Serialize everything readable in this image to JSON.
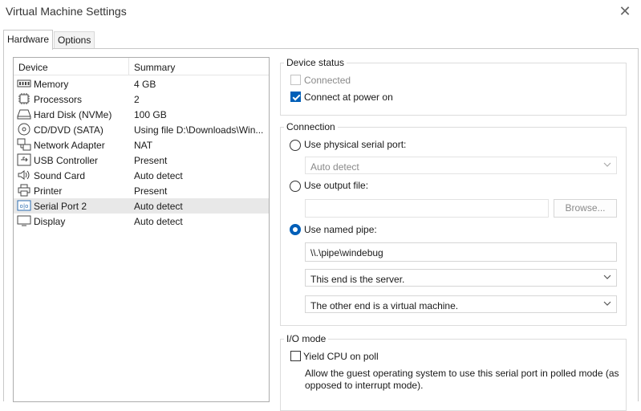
{
  "window": {
    "title": "Virtual Machine Settings",
    "close_glyph": "✕"
  },
  "tabs": [
    {
      "label": "Hardware",
      "active": true
    },
    {
      "label": "Options",
      "active": false
    }
  ],
  "device_list": {
    "headers": {
      "device": "Device",
      "summary": "Summary"
    },
    "rows": [
      {
        "icon": "memory-icon",
        "name": "Memory",
        "summary": "4 GB"
      },
      {
        "icon": "processor-icon",
        "name": "Processors",
        "summary": "2"
      },
      {
        "icon": "hard-disk-icon",
        "name": "Hard Disk (NVMe)",
        "summary": "100 GB"
      },
      {
        "icon": "cd-dvd-icon",
        "name": "CD/DVD (SATA)",
        "summary": "Using file D:\\Downloads\\Win..."
      },
      {
        "icon": "network-adapter-icon",
        "name": "Network Adapter",
        "summary": "NAT"
      },
      {
        "icon": "usb-controller-icon",
        "name": "USB Controller",
        "summary": "Present"
      },
      {
        "icon": "sound-card-icon",
        "name": "Sound Card",
        "summary": "Auto detect"
      },
      {
        "icon": "printer-icon",
        "name": "Printer",
        "summary": "Present"
      },
      {
        "icon": "serial-port-icon",
        "name": "Serial Port 2",
        "summary": "Auto detect",
        "selected": true
      },
      {
        "icon": "display-icon",
        "name": "Display",
        "summary": "Auto detect"
      }
    ]
  },
  "device_status": {
    "title": "Device status",
    "connected": {
      "label": "Connected",
      "checked": false,
      "enabled": false
    },
    "connect_at_power_on": {
      "label": "Connect at power on",
      "checked": true,
      "enabled": true
    }
  },
  "connection": {
    "title": "Connection",
    "physical_port": {
      "label": "Use physical serial port:",
      "selected": false,
      "value": "Auto detect"
    },
    "output_file": {
      "label": "Use output file:",
      "selected": false,
      "value": "",
      "browse_label": "Browse..."
    },
    "named_pipe": {
      "label": "Use named pipe:",
      "selected": true,
      "value": "\\\\.\\pipe\\windebug",
      "end_role": "This end is the server.",
      "other_end": "The other end is a virtual machine."
    }
  },
  "io_mode": {
    "title": "I/O mode",
    "yield_cpu": {
      "label": "Yield CPU on poll",
      "checked": false
    },
    "description": "Allow the guest operating system to use this serial port in polled mode (as opposed to interrupt mode)."
  },
  "colors": {
    "accent": "#005fb8",
    "selected_row": "#e8e8e8",
    "disabled_text": "#8a8a8a"
  }
}
